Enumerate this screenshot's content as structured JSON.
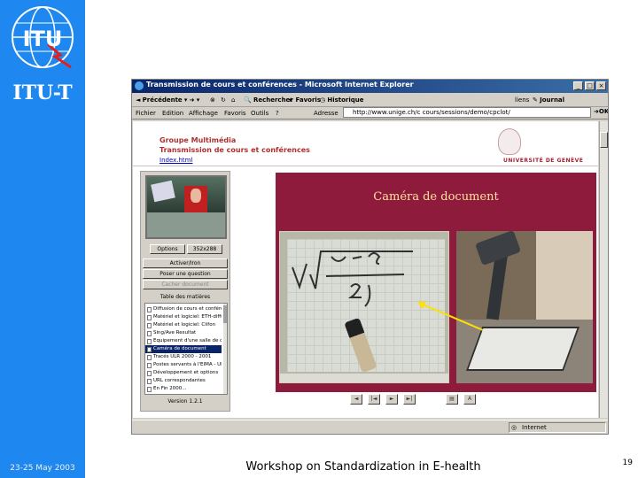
{
  "sidebar": {
    "logo_text": "ITU",
    "org": "ITU-T",
    "date": "23-25 May 2003"
  },
  "footer": {
    "title": "Workshop on Standardization in E-health",
    "page_number": "19"
  },
  "browser": {
    "title": "Transmission de cours et conférences - Microsoft Internet Explorer",
    "toolbar": {
      "back": "Précédente",
      "search": "Rechercher",
      "favorites": "Favoris",
      "history": "Historique",
      "links": "liens",
      "journal": "Journal"
    },
    "menu": {
      "file": "Fichier",
      "edit": "Edition",
      "view": "Affichage",
      "favorites": "Favoris",
      "tools": "Outils",
      "help": "?",
      "address_label": "Adresse"
    },
    "address": "http://www.unige.ch/c cours/sessions/demo/cpclot/",
    "go": "OK",
    "status_zone": "Internet",
    "icons": {
      "browser": "ie-icon",
      "internet": "globe-icon"
    }
  },
  "page": {
    "group_line1": "Groupe Multimédia",
    "group_line2": "Transmission de cours et conférences",
    "group_link": "Index.html",
    "university": "UNIVERSITÉ DE GENÈVE",
    "panel": {
      "buttons": [
        "Options",
        "352x288"
      ],
      "actions": [
        "Activer/Iron",
        "Poser une question",
        "Cacher document"
      ],
      "toc_heading": "Table des matières",
      "toc_items": [
        "Diffusion de cours et conférences",
        "Matériel et logiciel: ETH-diffusion",
        "Matériel et logiciel: Clifon",
        "Sing/Ave Resultat",
        "Equipement d'une salle de cours",
        "Caméra de document",
        "Tracés ULR 2000 - 2001",
        "Postes servants à l'EIMA - ULR",
        "Développement et options",
        "URL correspondantes",
        "En Fin 2000..."
      ],
      "selected_index": 5,
      "version": "Version 1.2.1"
    },
    "slide_title": "Caméra de document",
    "nav_buttons": [
      "prev-icon",
      "first-icon",
      "next-icon",
      "last-icon",
      "print-icon",
      "text-icon"
    ],
    "colors": {
      "band": "#1e88f0",
      "slide_bg": "#8e1b3c",
      "slide_title": "#ffe0a0",
      "group_text": "#b03030"
    }
  }
}
